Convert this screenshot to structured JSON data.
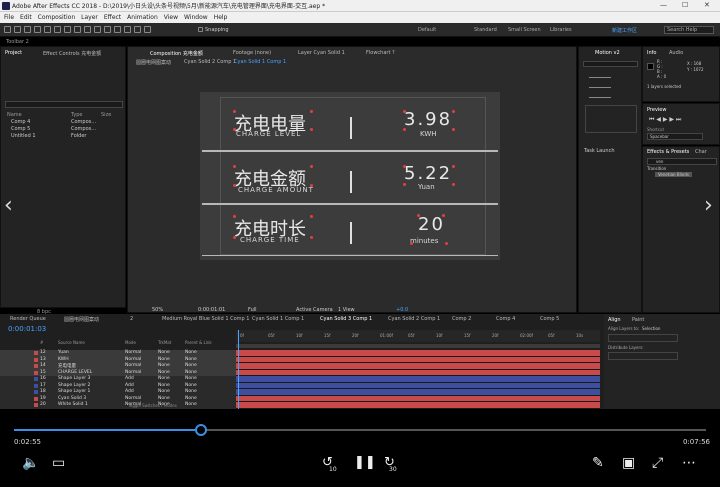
{
  "window": {
    "title": "Adobe After Effects CC 2018 - D:\\2019\\小日头设\\头条号视频\\5月\\新能源汽车\\充电管理界面\\充电界面-交互.aep *",
    "controls": [
      "—",
      "☐",
      "✕"
    ]
  },
  "menu": [
    "File",
    "Edit",
    "Composition",
    "Layer",
    "Effect",
    "Animation",
    "View",
    "Window",
    "Help"
  ],
  "toolbar": {
    "snapping": "Snapping",
    "workspaces": [
      "Default",
      "Standard",
      "Small Screen",
      "Libraries"
    ],
    "active_workspace": "新建工作区",
    "search_placeholder": "Search Help"
  },
  "tool_label": "Toolbar 2",
  "project_panel": {
    "tabs": [
      "Project",
      "Effect Controls 充电金额"
    ],
    "columns": [
      "Name",
      "Type",
      "Size"
    ],
    "items": [
      {
        "name": "Comp 4",
        "type": "Compos..."
      },
      {
        "name": "Comp 5",
        "type": "Compos..."
      },
      {
        "name": "Untitled 1",
        "type": "Folder"
      }
    ],
    "bit_depth": "8 bpc"
  },
  "viewer": {
    "tabs": [
      "Composition 充电金额",
      "Footage (none)",
      "Layer Cyan Solid 1",
      "Flowchart ?"
    ],
    "breadcrumbs": [
      "圆圈电网图案动",
      "Cyan Solid 2 Comp 1",
      "Cyan Solid 1 Comp 1"
    ],
    "rows": [
      {
        "cn": "充电电量",
        "en": "CHARGE LEVEL",
        "value": "3.98",
        "unit": "KWH"
      },
      {
        "cn": "充电金额",
        "en": "CHARGE AMOUNT",
        "value": "5.22",
        "unit": "Yuan"
      },
      {
        "cn": "充电时长",
        "en": "CHARGE TIME",
        "value": "20",
        "unit": "minutes"
      }
    ],
    "footer": {
      "zoom": "50%",
      "time": "0:00:01:01",
      "resolution": "Full",
      "camera": "Active Camera",
      "view": "1 View",
      "exposure": "+0.0"
    }
  },
  "right_panels": {
    "motion_tab": "Motion v2",
    "info_tab": "Info",
    "audio_tab": "Audio",
    "info_values": [
      "R :",
      "G :",
      "B :",
      "A : 0"
    ],
    "info_xy": [
      "X : 168",
      "Y : 1072"
    ],
    "info_selected": "1 layers selected",
    "task_launch": "Task Launch",
    "preview_tab": "Preview",
    "shortcut_label": "Shortcut",
    "shortcut_value": "Spacebar",
    "effects_tab": "Effects & Presets",
    "char_tab": "Char",
    "effects_search": "ven",
    "effects_group": "Transition",
    "effects_item": "Venetian Blinds"
  },
  "timeline": {
    "tabs": [
      "Render Queue",
      "圆圈电网图案动",
      "2",
      "Medium Royal Blue Solid 1 Comp 1",
      "Cyan Solid 1 Comp 1",
      "Cyan Solid 3 Comp 1",
      "Cyan Solid 2 Comp 1",
      "Comp 2",
      "Comp 4",
      "Comp 5"
    ],
    "time": "0:00:01:03",
    "col_headers": [
      "#",
      "Source Name",
      "Mode",
      "TrkMat",
      "Parent & Link"
    ],
    "ruler": [
      "0f",
      "05f",
      "10f",
      "15f",
      "20f",
      "01:00f",
      "05f",
      "10f",
      "15f",
      "20f",
      "02:00f",
      "05f",
      "10s"
    ],
    "layers": [
      {
        "num": "12",
        "name": "Yuan",
        "mode": "Normal",
        "trk": "None",
        "parent": "None",
        "color": "#c94a4a"
      },
      {
        "num": "13",
        "name": "KWH",
        "mode": "Normal",
        "trk": "None",
        "parent": "None",
        "color": "#c94a4a"
      },
      {
        "num": "14",
        "name": "充电电量",
        "mode": "Normal",
        "trk": "None",
        "parent": "None",
        "color": "#c94a4a"
      },
      {
        "num": "15",
        "name": "CHARGE LEVEL",
        "mode": "Normal",
        "trk": "None",
        "parent": "None",
        "color": "#c94a4a"
      },
      {
        "num": "16",
        "name": "Shape Layer 3",
        "mode": "Add",
        "trk": "None",
        "parent": "None",
        "color": "#3d4f9e"
      },
      {
        "num": "17",
        "name": "Shape Layer 2",
        "mode": "Add",
        "trk": "None",
        "parent": "None",
        "color": "#3d4f9e"
      },
      {
        "num": "18",
        "name": "Shape Layer 1",
        "mode": "Add",
        "trk": "None",
        "parent": "None",
        "color": "#3d4f9e"
      },
      {
        "num": "19",
        "name": "Cyan Solid 3",
        "mode": "Normal",
        "trk": "None",
        "parent": "None",
        "color": "#c94a4a"
      },
      {
        "num": "20",
        "name": "White Solid 1",
        "mode": "Normal",
        "trk": "None",
        "parent": "None",
        "color": "#c94a4a"
      }
    ],
    "footer": "Toggle Switches / Modes"
  },
  "align_panel": {
    "tabs": [
      "Align",
      "Paint"
    ],
    "align_to_label": "Align Layers to:",
    "align_to_value": "Selection",
    "distribute_label": "Distribute Layers:"
  },
  "player": {
    "current": "0:02:55",
    "total": "0:07:56",
    "progress": 0.27,
    "skip_back": "10",
    "skip_fwd": "30"
  }
}
